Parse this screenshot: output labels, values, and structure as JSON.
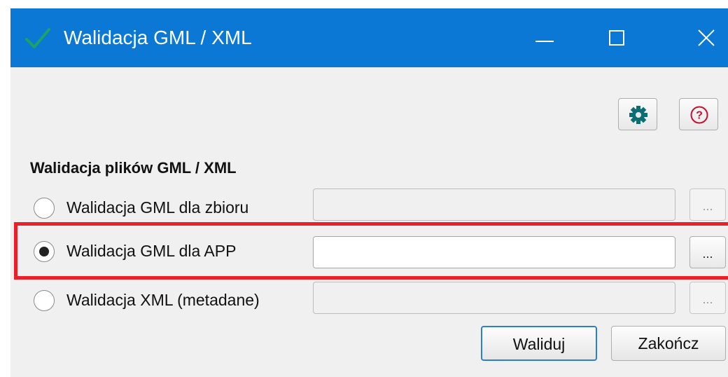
{
  "window": {
    "title": "Walidacja GML / XML",
    "icon": "checkmark-icon",
    "controls": [
      "minimize-icon",
      "maximize-icon",
      "close-icon"
    ],
    "accent_color": "#0a78d4"
  },
  "toolbar": {
    "settings_icon": "gear-icon",
    "help_icon": "question-circle-icon",
    "help_icon_color": "#c8102e",
    "settings_icon_color": "#0b6e74"
  },
  "section": {
    "title": "Walidacja plików GML / XML"
  },
  "options": [
    {
      "label": "Walidacja GML dla zbioru",
      "checked": false,
      "path_value": "",
      "browse_label": "...",
      "enabled": false
    },
    {
      "label": "Walidacja GML dla APP",
      "checked": true,
      "path_value": "",
      "browse_label": "...",
      "enabled": true
    },
    {
      "label": "Walidacja XML (metadane)",
      "checked": false,
      "path_value": "",
      "browse_label": "...",
      "enabled": false
    }
  ],
  "highlight_color": "#e8202a",
  "actions": {
    "validate_label": "Waliduj",
    "close_label": "Zakończ"
  }
}
